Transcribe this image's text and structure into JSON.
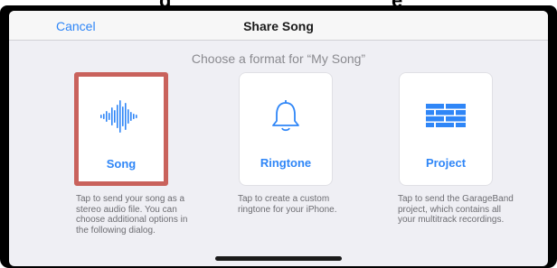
{
  "header": {
    "cancel_label": "Cancel",
    "title": "Share Song"
  },
  "subtitle": "Choose a format for “My Song”",
  "options": [
    {
      "label": "Song",
      "icon": "waveform-icon",
      "selected": true,
      "description": "Tap to send your song as a stereo audio file. You can choose additional options in the following dialog."
    },
    {
      "label": "Ringtone",
      "icon": "bell-icon",
      "selected": false,
      "description": "Tap to create a custom ringtone for your iPhone."
    },
    {
      "label": "Project",
      "icon": "bricks-icon",
      "selected": false,
      "description": "Tap to send the GarageBand project, which contains all your multitrack recordings."
    }
  ],
  "colors": {
    "accent": "#2f86f7",
    "selection_border": "#c9625c",
    "sheet_background": "#efeff4"
  }
}
